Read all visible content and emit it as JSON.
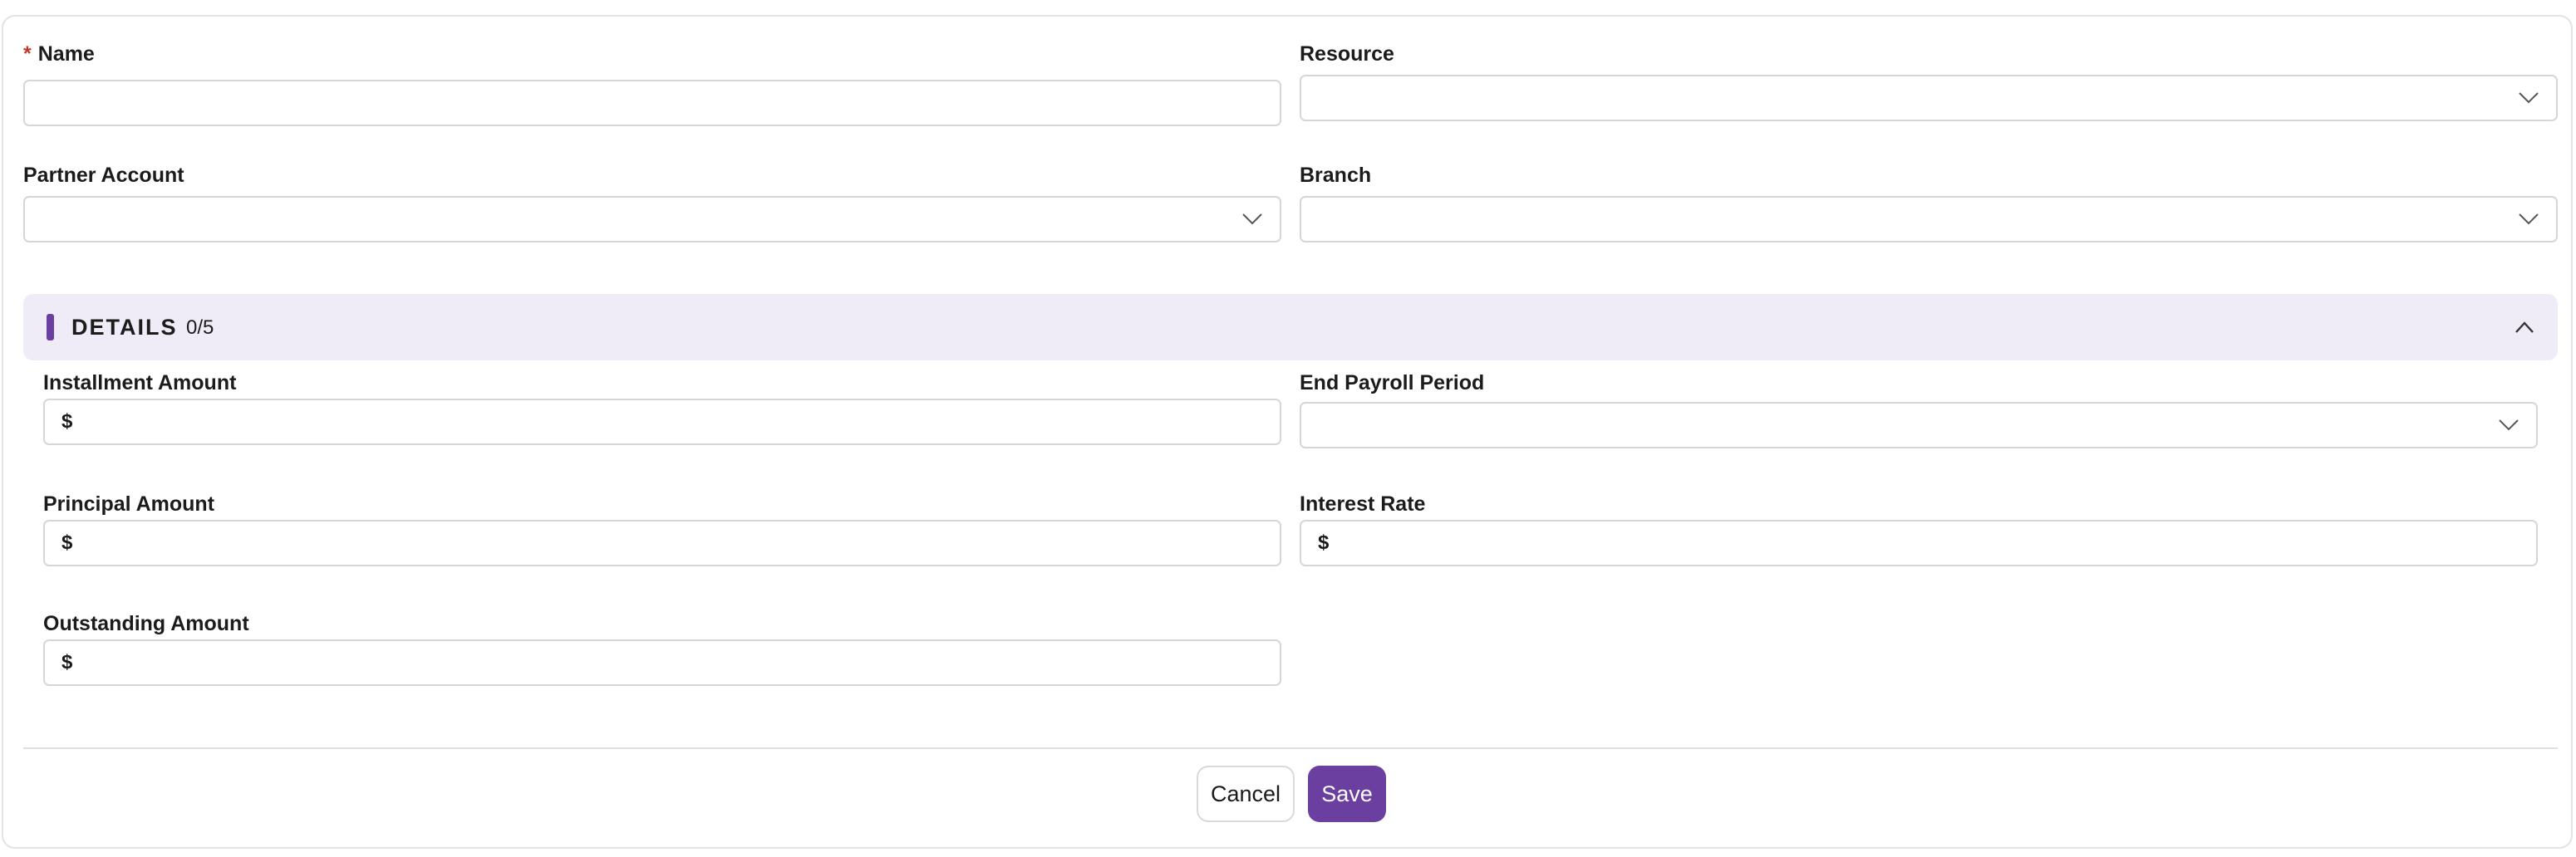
{
  "form": {
    "name": {
      "label": "Name",
      "required_mark": "*",
      "value": ""
    },
    "resource": {
      "label": "Resource",
      "value": ""
    },
    "partner_account": {
      "label": "Partner Account",
      "value": ""
    },
    "branch": {
      "label": "Branch",
      "value": ""
    }
  },
  "details": {
    "title": "DETAILS",
    "count": "0/5",
    "fields": {
      "installment_amount": {
        "label": "Installment Amount",
        "prefix": "$",
        "value": ""
      },
      "end_payroll_period": {
        "label": "End Payroll Period",
        "value": ""
      },
      "principal_amount": {
        "label": "Principal Amount",
        "prefix": "$",
        "value": ""
      },
      "interest_rate": {
        "label": "Interest Rate",
        "prefix": "$",
        "value": ""
      },
      "outstanding_amount": {
        "label": "Outstanding Amount",
        "prefix": "$",
        "value": ""
      }
    }
  },
  "actions": {
    "cancel_label": "Cancel",
    "save_label": "Save"
  },
  "colors": {
    "accent": "#6b3fa0",
    "section_bg": "#efecf7",
    "required": "#c0392b"
  },
  "icons": {
    "dropdown": "chevron-down-icon",
    "collapse": "chevron-up-icon"
  }
}
